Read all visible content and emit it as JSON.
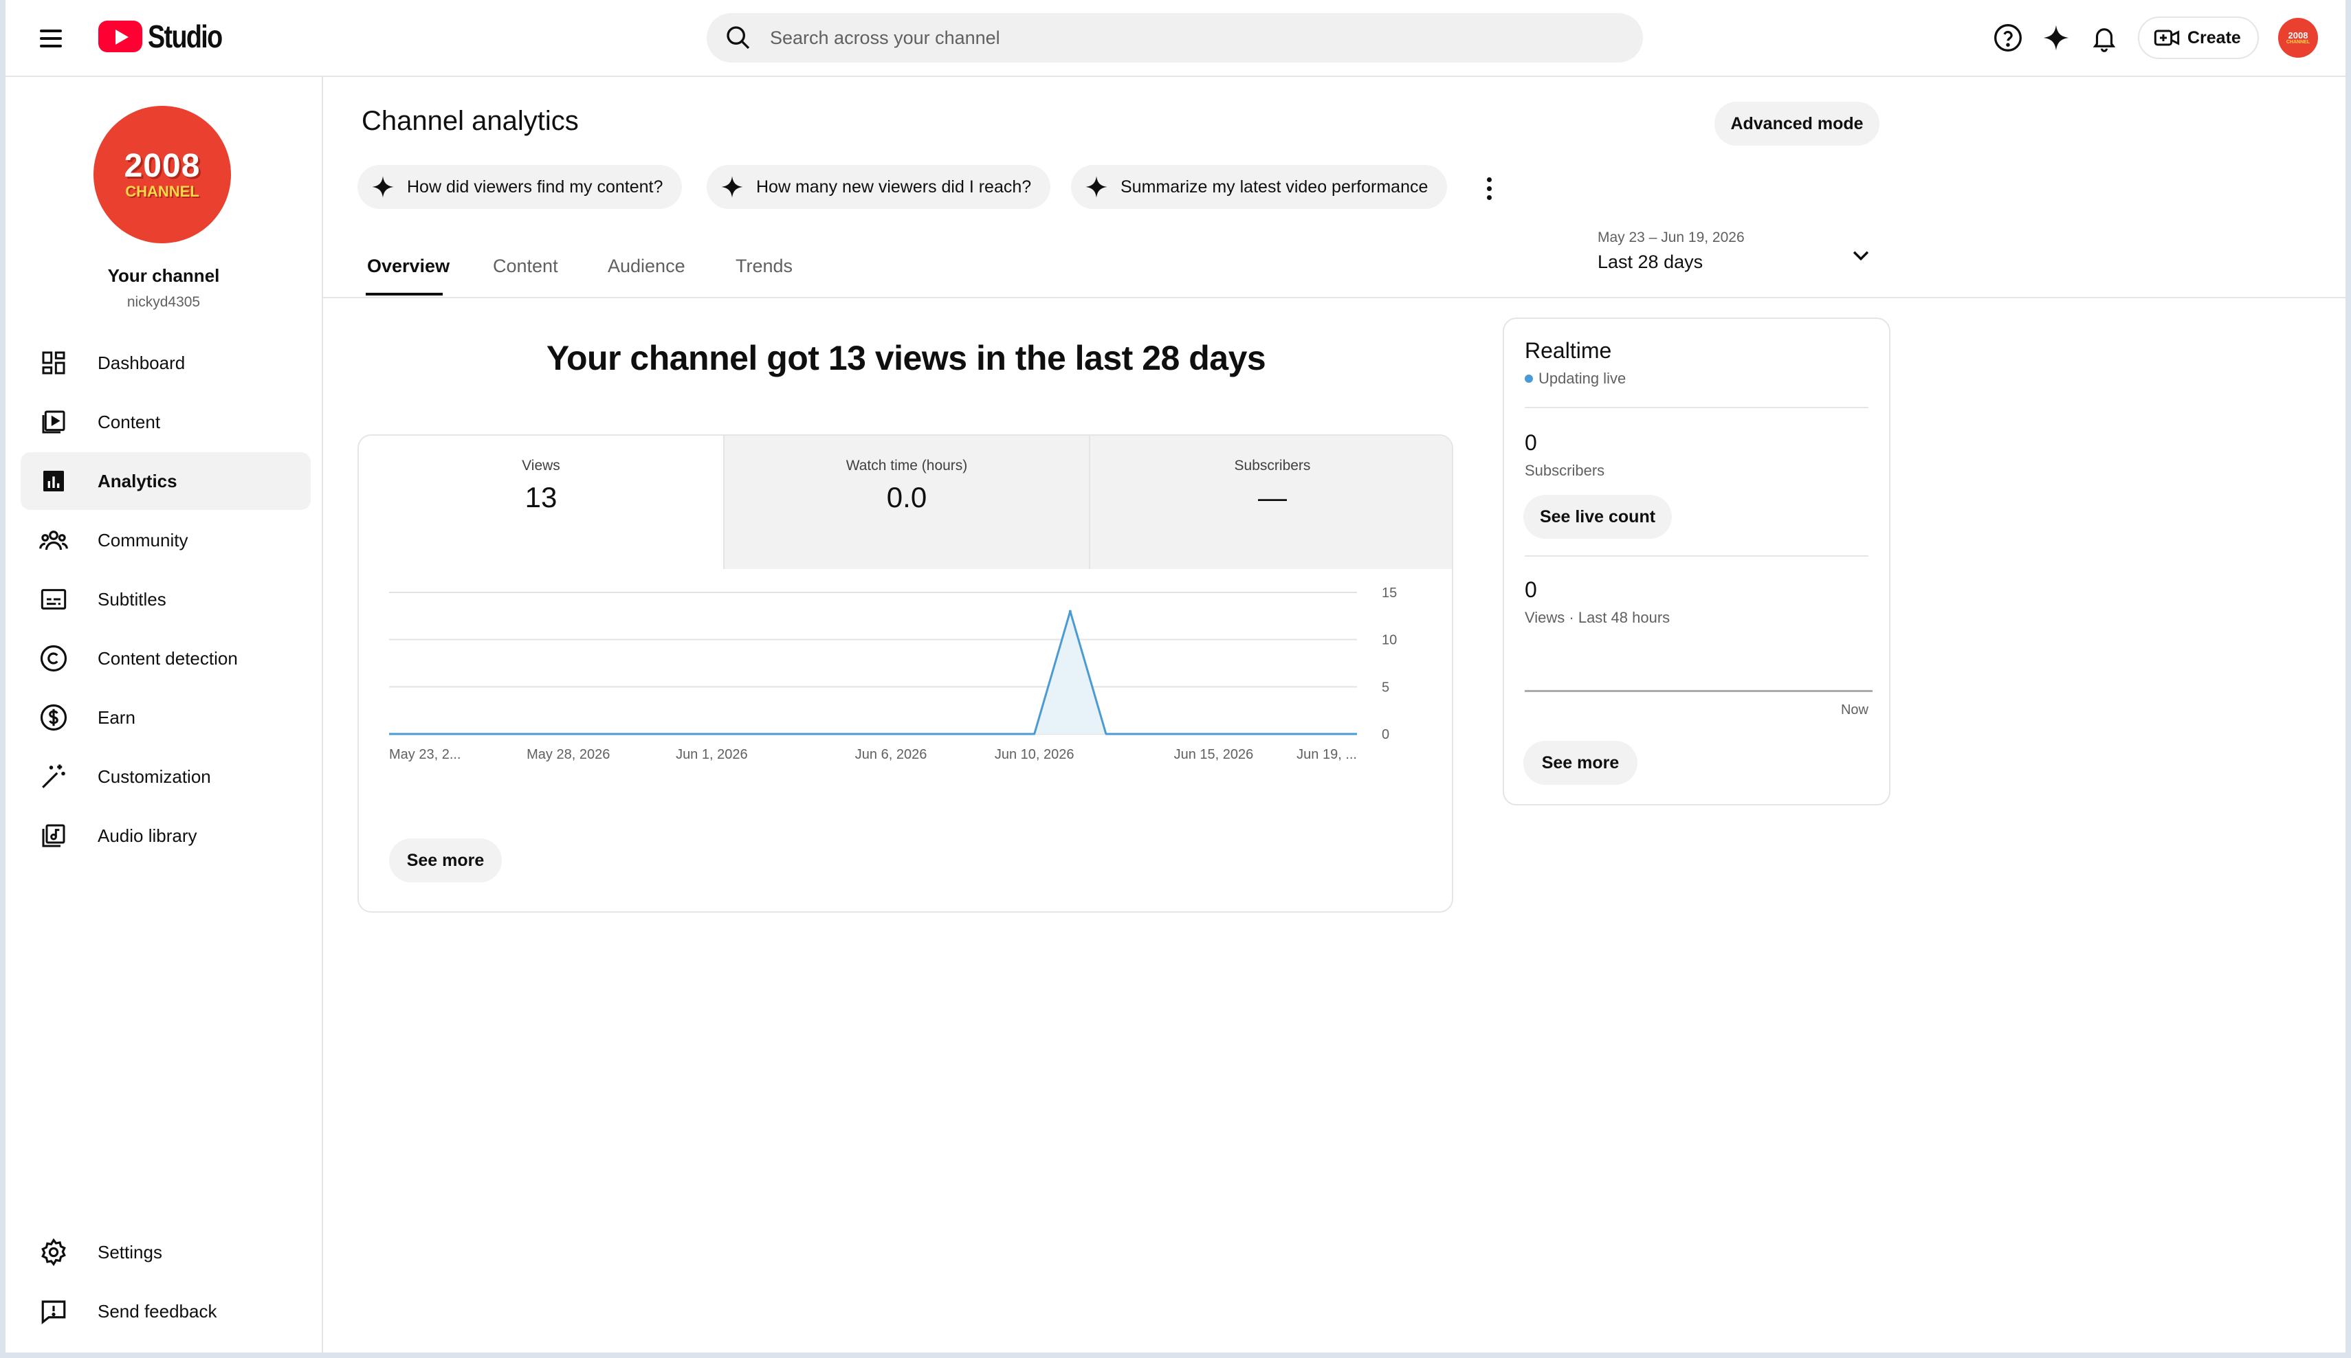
{
  "header": {
    "logo_text": "Studio",
    "search_placeholder": "Search across your channel",
    "create_label": "Create",
    "avatar_line1": "2008",
    "avatar_line2": "CHANNEL"
  },
  "sidebar": {
    "avatar_line1": "2008",
    "avatar_line2": "CHANNEL",
    "channel_name": "Your channel",
    "handle": "nickyd4305",
    "items": [
      {
        "label": "Dashboard",
        "icon": "dashboard-icon"
      },
      {
        "label": "Content",
        "icon": "content-icon"
      },
      {
        "label": "Analytics",
        "icon": "analytics-icon",
        "active": true
      },
      {
        "label": "Community",
        "icon": "community-icon"
      },
      {
        "label": "Subtitles",
        "icon": "subtitles-icon"
      },
      {
        "label": "Content detection",
        "icon": "copyright-icon"
      },
      {
        "label": "Earn",
        "icon": "dollar-icon"
      },
      {
        "label": "Customization",
        "icon": "magic-wand-icon"
      },
      {
        "label": "Audio library",
        "icon": "audio-library-icon"
      }
    ],
    "bottom_items": [
      {
        "label": "Settings",
        "icon": "gear-icon"
      },
      {
        "label": "Send feedback",
        "icon": "feedback-icon"
      }
    ]
  },
  "main": {
    "title": "Channel analytics",
    "advanced_mode": "Advanced mode",
    "chips": [
      "How did viewers find my content?",
      "How many new viewers did I reach?",
      "Summarize my latest video performance"
    ],
    "tabs": [
      "Overview",
      "Content",
      "Audience",
      "Trends"
    ],
    "active_tab": "Overview",
    "date_range": "May 23 – Jun 19, 2026",
    "date_label": "Last 28 days",
    "headline": "Your channel got 13 views in the last 28 days",
    "metrics": [
      {
        "label": "Views",
        "value": "13"
      },
      {
        "label": "Watch time (hours)",
        "value": "0.0"
      },
      {
        "label": "Subscribers",
        "value": "—"
      }
    ],
    "see_more": "See more"
  },
  "chart_data": {
    "type": "area",
    "series": [
      {
        "x": [
          "May 23, 2026",
          "May 24, 2026",
          "May 25, 2026",
          "May 26, 2026",
          "May 27, 2026",
          "May 28, 2026",
          "May 29, 2026",
          "May 30, 2026",
          "May 31, 2026",
          "Jun 1, 2026",
          "Jun 2, 2026",
          "Jun 3, 2026",
          "Jun 4, 2026",
          "Jun 5, 2026",
          "Jun 6, 2026",
          "Jun 7, 2026",
          "Jun 8, 2026",
          "Jun 9, 2026",
          "Jun 10, 2026",
          "Jun 11, 2026",
          "Jun 12, 2026",
          "Jun 13, 2026",
          "Jun 14, 2026",
          "Jun 15, 2026",
          "Jun 16, 2026",
          "Jun 17, 2026",
          "Jun 18, 2026",
          "Jun 19, 2026"
        ],
        "values": [
          0,
          0,
          0,
          0,
          0,
          0,
          0,
          0,
          0,
          0,
          0,
          0,
          0,
          0,
          0,
          0,
          0,
          0,
          0,
          13,
          0,
          0,
          0,
          0,
          0,
          0,
          0,
          0
        ]
      }
    ],
    "x_tick_labels": [
      "May 23, 2...",
      "May 28, 2026",
      "Jun 1, 2026",
      "Jun 6, 2026",
      "Jun 10, 2026",
      "Jun 15, 2026",
      "Jun 19, ..."
    ],
    "x_tick_days": [
      0,
      5,
      9,
      14,
      18,
      23,
      27
    ],
    "y_ticks": [
      0,
      5,
      10,
      15
    ],
    "ylim": [
      0,
      15
    ],
    "grid": true,
    "line_color": "#4a9ad4",
    "fill_color": "#e8f2f9"
  },
  "realtime": {
    "title": "Realtime",
    "status": "Updating live",
    "subscribers_value": "0",
    "subscribers_label": "Subscribers",
    "live_count_button": "See live count",
    "views_value": "0",
    "views_label": "Views · Last 48 hours",
    "now_label": "Now",
    "see_more": "See more"
  }
}
